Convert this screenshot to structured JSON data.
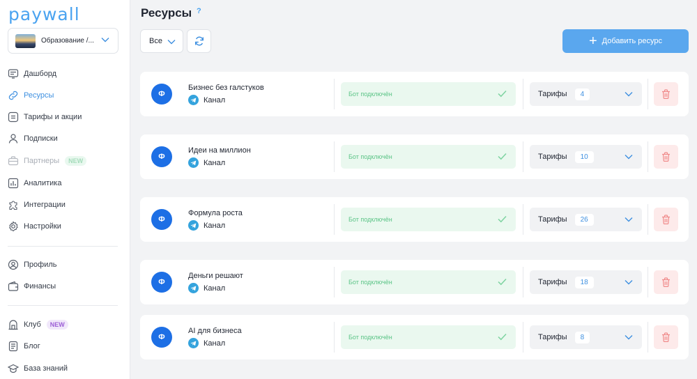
{
  "app": {
    "logo": "paywall"
  },
  "workspace": {
    "name": "Образование /..."
  },
  "sidebar": {
    "items": [
      {
        "key": "dashboard",
        "label": "Дашборд",
        "icon": "dashboard-icon"
      },
      {
        "key": "resources",
        "label": "Ресурсы",
        "icon": "resources-icon",
        "active": true
      },
      {
        "key": "tariffs",
        "label": "Тарифы и акции",
        "icon": "tariffs-icon"
      },
      {
        "key": "subscriptions",
        "label": "Подписки",
        "icon": "user-icon"
      },
      {
        "key": "partners",
        "label": "Партнеры",
        "icon": "briefcase-icon",
        "badge": "NEW"
      },
      {
        "key": "analytics",
        "label": "Аналитика",
        "icon": "chart-icon"
      },
      {
        "key": "integrations",
        "label": "Интеграции",
        "icon": "puzzle-icon"
      },
      {
        "key": "settings",
        "label": "Настройки",
        "icon": "gear-icon"
      },
      {
        "key": "profile",
        "label": "Профиль",
        "icon": "profile-icon"
      },
      {
        "key": "finance",
        "label": "Финансы",
        "icon": "wallet-icon"
      },
      {
        "key": "club",
        "label": "Клуб",
        "icon": "club-icon",
        "badge": "NEW"
      },
      {
        "key": "blog",
        "label": "Блог",
        "icon": "blog-icon"
      },
      {
        "key": "knowledge",
        "label": "База знаний",
        "icon": "graduation-icon"
      }
    ]
  },
  "main": {
    "title": "Ресурсы",
    "help": "?",
    "filter_value": "Все",
    "add_button": "Добавить ресурс",
    "resources": [
      {
        "avatar": "Ф",
        "name": "Бизнес без галстуков",
        "type": "Канал",
        "status": "Бот подключён",
        "tariffs_label": "Тарифы",
        "tariffs_count": "4"
      },
      {
        "avatar": "Ф",
        "name": "Идеи на миллион",
        "type": "Канал",
        "status": "Бот подключён",
        "tariffs_label": "Тарифы",
        "tariffs_count": "10"
      },
      {
        "avatar": "Ф",
        "name": "Формула роста",
        "type": "Канал",
        "status": "Бот подключён",
        "tariffs_label": "Тарифы",
        "tariffs_count": "26"
      },
      {
        "avatar": "Ф",
        "name": "Деньги решают",
        "type": "Канал",
        "status": "Бот подключён",
        "tariffs_label": "Тарифы",
        "tariffs_count": "18"
      },
      {
        "avatar": "Ф",
        "name": "AI для бизнеса",
        "type": "Канал",
        "status": "Бот подключён",
        "tariffs_label": "Тарифы",
        "tariffs_count": "8"
      }
    ]
  },
  "colors": {
    "accent": "#4aa3f0",
    "primary_button": "#5aa7ee",
    "status_bg": "#eaf8ef",
    "status_text": "#5cc487",
    "delete_bg": "#fdeaea",
    "delete_icon": "#f08a8a"
  }
}
